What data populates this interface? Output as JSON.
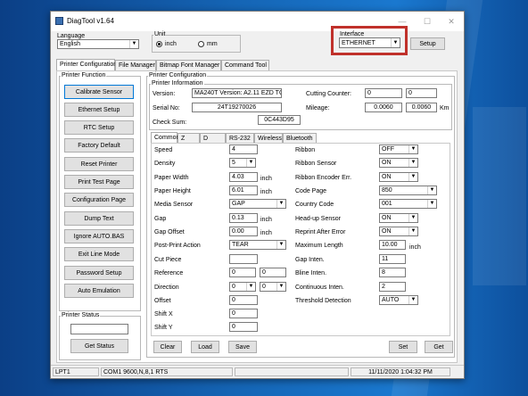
{
  "window": {
    "title": "DiagTool v1.64"
  },
  "language": {
    "label": "Language",
    "value": "English"
  },
  "unit": {
    "label": "Unit",
    "inch": "inch",
    "mm": "mm",
    "selected": "inch"
  },
  "interface": {
    "label": "Interface",
    "value": "ETHERNET",
    "setup": "Setup"
  },
  "main_tabs": [
    "Printer Configuration",
    "File Manager",
    "Bitmap Font Manager",
    "Command Tool"
  ],
  "printer_function": {
    "label": "Printer Function",
    "buttons": [
      "Calibrate Sensor",
      "Ethernet Setup",
      "RTC Setup",
      "Factory Default",
      "Reset Printer",
      "Print Test Page",
      "Configuration Page",
      "Dump Text",
      "Ignore AUTO.BAS",
      "Exit Line Mode",
      "Password Setup",
      "Auto Emulation"
    ]
  },
  "printer_status": {
    "label": "Printer Status",
    "get_status": "Get Status"
  },
  "printer_config": {
    "label": "Printer Configuration"
  },
  "printer_info": {
    "label": "Printer Information",
    "version_label": "Version:",
    "version": "MA240T Version: A2.11 EZD TCF",
    "serial_label": "Serial No:",
    "serial": "24T19270026",
    "checksum_label": "Check Sum:",
    "checksum": "0C443D95",
    "cutting_label": "Cutting Counter:",
    "cutting_1": "0",
    "cutting_2": "0",
    "mileage_label": "Mileage:",
    "mileage_1": "0.0060",
    "mileage_2": "0.0060",
    "mileage_unit": "Km"
  },
  "sub_tabs": [
    "Common",
    "Z",
    "D",
    "RS-232",
    "Wireless",
    "Bluetooth"
  ],
  "left_fields": {
    "speed": {
      "label": "Speed",
      "value": "4"
    },
    "density": {
      "label": "Density",
      "value": "5"
    },
    "paper_width": {
      "label": "Paper Width",
      "value": "4.03",
      "unit": "inch"
    },
    "paper_height": {
      "label": "Paper Height",
      "value": "6.01",
      "unit": "inch"
    },
    "media_sensor": {
      "label": "Media Sensor",
      "value": "GAP"
    },
    "gap": {
      "label": "Gap",
      "value": "0.13",
      "unit": "inch"
    },
    "gap_offset": {
      "label": "Gap Offset",
      "value": "0.00",
      "unit": "inch"
    },
    "post_print": {
      "label": "Post-Print Action",
      "value": "TEAR"
    },
    "cut_piece": {
      "label": "Cut Piece",
      "value": ""
    },
    "reference": {
      "label": "Reference",
      "value1": "0",
      "value2": "0"
    },
    "direction": {
      "label": "Direction",
      "value1": "0",
      "value2": "0"
    },
    "offset": {
      "label": "Offset",
      "value": "0"
    },
    "shift_x": {
      "label": "Shift X",
      "value": "0"
    },
    "shift_y": {
      "label": "Shift Y",
      "value": "0"
    }
  },
  "right_fields": {
    "ribbon": {
      "label": "Ribbon",
      "value": "OFF"
    },
    "ribbon_sensor": {
      "label": "Ribbon Sensor",
      "value": "ON"
    },
    "ribbon_encoder": {
      "label": "Ribbon Encoder Err.",
      "value": "ON"
    },
    "code_page": {
      "label": "Code Page",
      "value": "850"
    },
    "country_code": {
      "label": "Country Code",
      "value": "001"
    },
    "headup_sensor": {
      "label": "Head-up Sensor",
      "value": "ON"
    },
    "reprint": {
      "label": "Reprint After Error",
      "value": "ON"
    },
    "max_length": {
      "label": "Maximum Length",
      "value": "10.00",
      "unit": "inch"
    },
    "gap_inten": {
      "label": "Gap Inten.",
      "value": "11"
    },
    "bline_inten": {
      "label": "Bline Inten.",
      "value": "8"
    },
    "continuous_inten": {
      "label": "Continuous Inten.",
      "value": "2"
    },
    "threshold": {
      "label": "Threshold Detection",
      "value": "AUTO"
    }
  },
  "bottom_buttons": {
    "clear": "Clear",
    "load": "Load",
    "save": "Save",
    "set": "Set",
    "get": "Get"
  },
  "statusbar": {
    "port": "LPT1",
    "com": "COM1 9600,N,8,1 RTS",
    "datetime": "11/11/2020 1:04:32 PM"
  },
  "colors": {
    "highlight": "#c0312b",
    "desktop": "#1565b5"
  }
}
